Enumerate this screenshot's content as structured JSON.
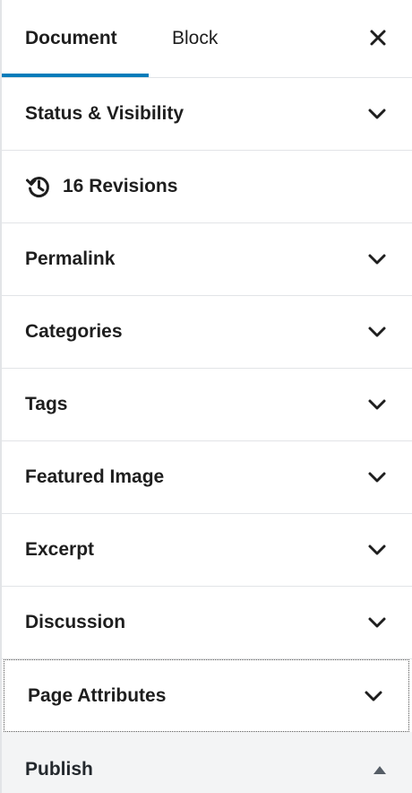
{
  "tabs": {
    "document": "Document",
    "block": "Block"
  },
  "panels": {
    "status": "Status & Visibility",
    "revisions": "16 Revisions",
    "permalink": "Permalink",
    "categories": "Categories",
    "tags": "Tags",
    "featured_image": "Featured Image",
    "excerpt": "Excerpt",
    "discussion": "Discussion",
    "page_attributes": "Page Attributes",
    "publish": "Publish"
  },
  "icons": {
    "close": "close-icon",
    "chevron": "chevron-down-icon",
    "revisions": "history-icon",
    "publish_toggle": "triangle-up-icon"
  },
  "colors": {
    "accent": "#007cba",
    "text": "#1e1e1e",
    "border": "#e2e4e7"
  }
}
